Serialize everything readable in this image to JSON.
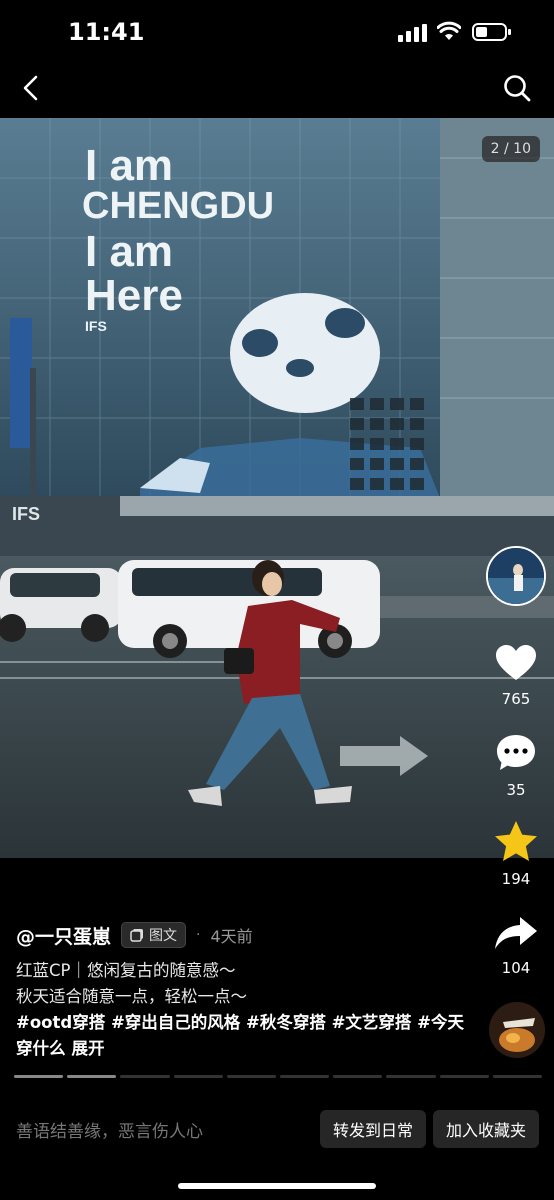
{
  "status_bar": {
    "time": "11:41"
  },
  "photo": {
    "counter": "2 / 10",
    "billboard_lines": [
      "I am",
      "CHENGDU",
      "I am",
      "Here"
    ],
    "billboard_brand": "IFS",
    "storefront_text": "IFS"
  },
  "actions": {
    "likes": "765",
    "comments": "35",
    "favorites": "194",
    "shares": "104"
  },
  "post": {
    "author": "@一只蛋崽",
    "badge": "图文",
    "separator": "·",
    "time_ago": "4天前",
    "caption_lines": [
      "红蓝CP｜悠闲复古的随意感～",
      "秋天适合随意一点，轻松一点～"
    ],
    "hashtags": "#ootd穿搭 #穿出自己的风格 #秋冬穿搭 #文艺穿搭 #今天穿什么",
    "expand": "展开"
  },
  "progress": {
    "total": 10,
    "current": 2
  },
  "bottom_bar": {
    "comment_placeholder": "善语结善缘，恶言伤人心",
    "forward_button": "转发到日常",
    "favorite_button": "加入收藏夹"
  },
  "colors": {
    "star": "#f5c518",
    "background": "#000000"
  }
}
